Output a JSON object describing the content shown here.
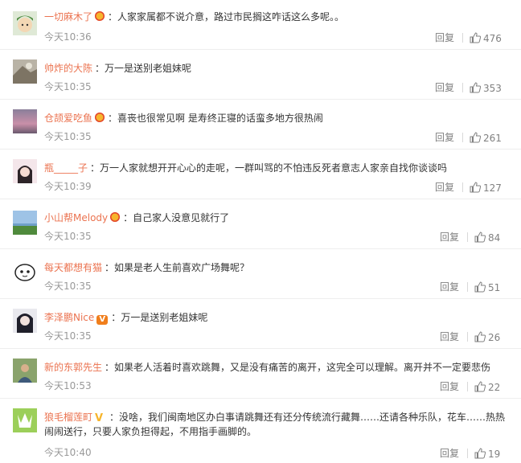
{
  "comments": [
    {
      "user": "一切麻木了",
      "badge": "crown",
      "text": "人家家属都不说介意，路过市民搁这咋话这么多呢。。",
      "time": "今天10:36",
      "reply": "回复",
      "likes": "476"
    },
    {
      "user": "帅炸的大陈",
      "badge": "",
      "text": "万一是送别老姐妹呢",
      "time": "今天10:35",
      "reply": "回复",
      "likes": "353"
    },
    {
      "user": "仓颉爱吃鱼",
      "badge": "crown",
      "text": "喜丧也很常见啊 是寿终正寝的话蛮多地方很热闹",
      "time": "今天10:35",
      "reply": "回复",
      "likes": "261"
    },
    {
      "user": "瓶_____子",
      "badge": "",
      "text": "万一人家就想开开心心的走呢，一群叫骂的不怕违反死者意志人家亲自找你谈谈吗",
      "time": "今天10:39",
      "reply": "回复",
      "likes": "127"
    },
    {
      "user": "小山帮Melody",
      "badge": "crown",
      "text": "自己家人没意见就行了",
      "time": "今天10:35",
      "reply": "回复",
      "likes": "84"
    },
    {
      "user": "每天都想有猫",
      "badge": "",
      "text": "如果是老人生前喜欢广场舞呢？",
      "time": "今天10:35",
      "reply": "回复",
      "likes": "51"
    },
    {
      "user": "李泽鹏Nice",
      "badge": "vip",
      "text": "万一是送别老姐妹呢",
      "time": "今天10:35",
      "reply": "回复",
      "likes": "26"
    },
    {
      "user": "新的东郭先生",
      "badge": "",
      "text": "如果老人活着时喜欢跳舞，又是没有痛苦的离开，这完全可以理解。离开并不一定要悲伤",
      "time": "今天10:53",
      "reply": "回复",
      "likes": "22"
    },
    {
      "user": "狼毛榴莲町",
      "badge": "vyellow",
      "text": "没啥，我们闽南地区办白事请跳舞还有还分传统流行藏舞……还请各种乐队，花车……热热闹闹送行，只要人家负担得起，不用指手画脚的。",
      "time": "今天10:40",
      "reply": "回复",
      "likes": "19"
    }
  ],
  "colors": {
    "username": "#eb7350",
    "meta": "#999999",
    "divider": "#eeeeee"
  }
}
